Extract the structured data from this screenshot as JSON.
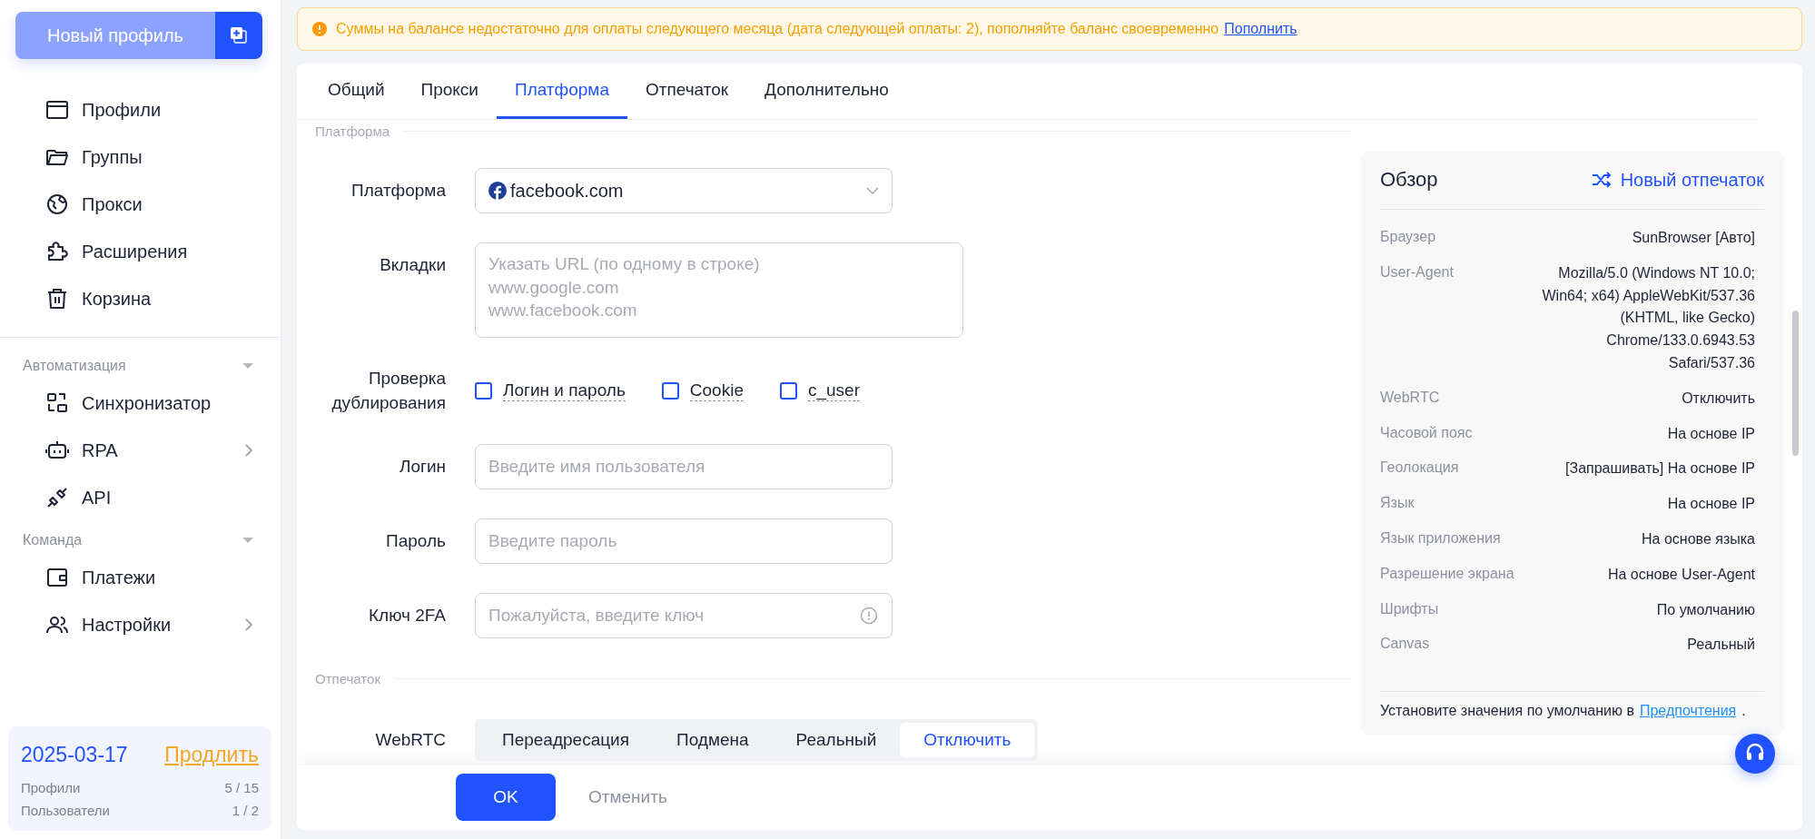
{
  "sidebar": {
    "new_profile_button": "Новый профиль",
    "groups": [
      {
        "items": [
          {
            "label": "Профили",
            "expandable": false
          },
          {
            "label": "Группы",
            "expandable": false
          },
          {
            "label": "Прокси",
            "expandable": false
          },
          {
            "label": "Расширения",
            "expandable": false
          },
          {
            "label": "Корзина",
            "expandable": false
          }
        ]
      },
      {
        "title": "Автоматизация",
        "expanded": true,
        "items": [
          {
            "label": "Синхронизатор",
            "expandable": false
          },
          {
            "label": "RPA",
            "expandable": true
          },
          {
            "label": "API",
            "expandable": false
          }
        ]
      },
      {
        "title": "Команда",
        "expanded": true,
        "items": [
          {
            "label": "Платежи",
            "expandable": false
          },
          {
            "label": "Настройки",
            "expandable": true
          }
        ]
      }
    ],
    "plan": {
      "date": "2025-03-17",
      "renew_link": "Продлить",
      "stats": [
        {
          "label": "Профили",
          "value": "5 / 15"
        },
        {
          "label": "Пользователи",
          "value": "1 / 2"
        }
      ]
    }
  },
  "banner": {
    "text": "Суммы на балансе недостаточно для оплаты следующего месяца (дата следующей оплаты: 2), пополняйте баланс своевременно",
    "link": "Пополнить"
  },
  "tabs": [
    {
      "label": "Общий",
      "selected": false
    },
    {
      "label": "Прокси",
      "selected": false
    },
    {
      "label": "Платформа",
      "selected": true
    },
    {
      "label": "Отпечаток",
      "selected": false
    },
    {
      "label": "Дополнительно",
      "selected": false
    }
  ],
  "platform_section": {
    "title": "Платформа",
    "platform": {
      "label": "Платформа",
      "value": "facebook.com"
    },
    "tabs_field": {
      "label": "Вкладки",
      "placeholder": "Указать URL (по одному в строке)\nwww.google.com\nwww.facebook.com"
    },
    "duplicate_check": {
      "label": "Проверка дублирования",
      "options": [
        {
          "label": "Логин и пароль",
          "checked": false
        },
        {
          "label": "Cookie",
          "checked": false
        },
        {
          "label": "c_user",
          "checked": false
        }
      ]
    },
    "login": {
      "label": "Логин",
      "placeholder": "Введите имя пользователя"
    },
    "password": {
      "label": "Пароль",
      "placeholder": "Введите пароль"
    },
    "twofa": {
      "label": "Ключ 2FA",
      "placeholder": "Пожалуйста, введите ключ"
    }
  },
  "fingerprint_section": {
    "title": "Отпечаток",
    "webrtc": {
      "label": "WebRTC",
      "options": [
        {
          "label": "Переадресация",
          "selected": false
        },
        {
          "label": "Подмена",
          "selected": false
        },
        {
          "label": "Реальный",
          "selected": false
        },
        {
          "label": "Отключить",
          "selected": true
        }
      ]
    }
  },
  "overview": {
    "title": "Обзор",
    "new_fingerprint_button": "Новый отпечаток",
    "rows": [
      {
        "label": "Браузер",
        "value": "SunBrowser [Авто]"
      },
      {
        "label": "User-Agent",
        "value": "Mozilla/5.0 (Windows NT 10.0; Win64; x64) AppleWebKit/537.36 (KHTML, like Gecko) Chrome/133.0.6943.53 Safari/537.36"
      },
      {
        "label": "WebRTC",
        "value": "Отключить"
      },
      {
        "label": "Часовой пояс",
        "value": "На основе IP"
      },
      {
        "label": "Геолокация",
        "value": "[Запрашивать] На основе IP"
      },
      {
        "label": "Язык",
        "value": "На основе IP"
      },
      {
        "label": "Язык приложения",
        "value": "На основе языка"
      },
      {
        "label": "Разрешение экрана",
        "value": "На основе User-Agent"
      },
      {
        "label": "Шрифты",
        "value": "По умолчанию"
      },
      {
        "label": "Canvas",
        "value": "Реальный"
      }
    ],
    "note": "Установите значения по умолчанию в",
    "note_link": "Предпочтения",
    "note_end": "."
  },
  "footer": {
    "ok_button": "OK",
    "cancel_button": "Отменить"
  }
}
